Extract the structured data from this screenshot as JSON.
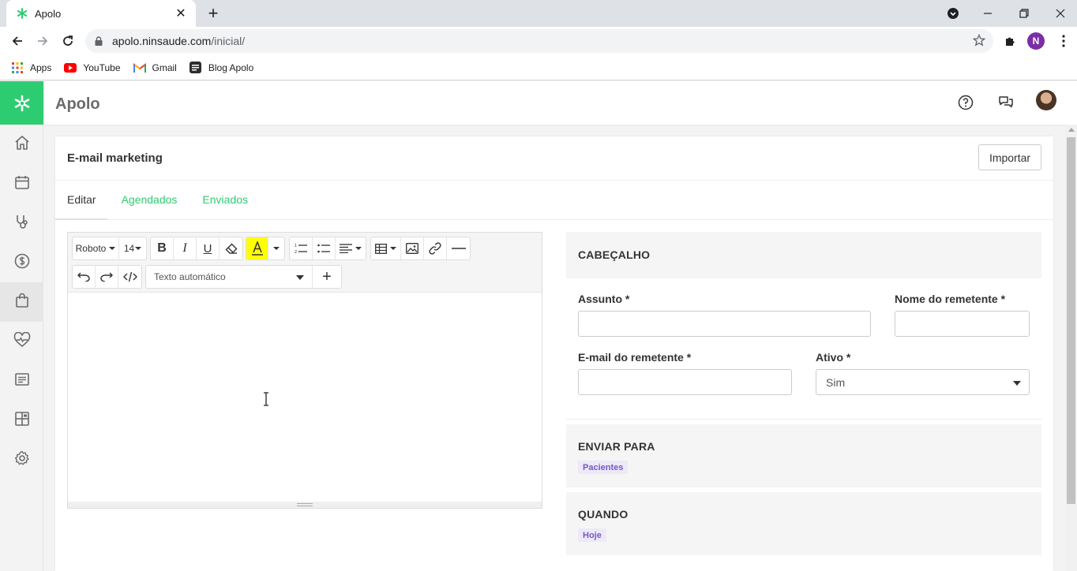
{
  "browser": {
    "tab_title": "Apolo",
    "url_host": "apolo.ninsaude.com",
    "url_path": "/inicial/",
    "profile_initial": "N",
    "bookmarks": [
      {
        "label": "Apps",
        "icon": "apps-grid-icon"
      },
      {
        "label": "YouTube",
        "icon": "youtube-icon"
      },
      {
        "label": "Gmail",
        "icon": "gmail-icon"
      },
      {
        "label": "Blog Apolo",
        "icon": "blog-icon"
      }
    ]
  },
  "app": {
    "title": "Apolo",
    "brand_color": "#2ecc71",
    "sidebar": [
      {
        "icon": "home-icon"
      },
      {
        "icon": "calendar-icon"
      },
      {
        "icon": "stethoscope-icon"
      },
      {
        "icon": "dollar-icon"
      },
      {
        "icon": "bag-icon",
        "active": true
      },
      {
        "icon": "heart-pulse-icon"
      },
      {
        "icon": "list-icon"
      },
      {
        "icon": "dashboard-icon"
      },
      {
        "icon": "gear-icon"
      }
    ]
  },
  "page": {
    "title": "E-mail marketing",
    "import_label": "Importar",
    "tabs": [
      {
        "label": "Editar",
        "active": true
      },
      {
        "label": "Agendados"
      },
      {
        "label": "Enviados"
      }
    ],
    "editor": {
      "font_name": "Roboto",
      "font_size": "14",
      "auto_text": "Texto automático",
      "highlight_color": "#ffff00"
    },
    "header_section": {
      "title": "CABEÇALHO",
      "subject_label": "Assunto *",
      "subject_value": "",
      "sender_name_label": "Nome do remetente *",
      "sender_name_value": "",
      "sender_email_label": "E-mail do remetente *",
      "sender_email_value": "",
      "active_label": "Ativo *",
      "active_value": "Sim"
    },
    "send_to": {
      "title": "ENVIAR PARA",
      "badge": "Pacientes"
    },
    "when": {
      "title": "QUANDO",
      "badge": "Hoje"
    }
  }
}
